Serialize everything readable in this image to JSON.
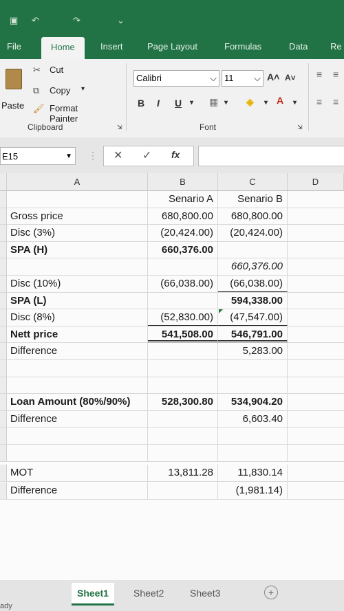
{
  "ribbon_tabs": [
    "File",
    "Home",
    "Insert",
    "Page Layout",
    "Formulas",
    "Data",
    "Re"
  ],
  "clipboard": {
    "paste": "Paste",
    "cut": "Cut",
    "copy": "Copy",
    "format_painter": "Format Painter",
    "group": "Clipboard"
  },
  "font": {
    "name": "Calibri",
    "size": "11",
    "group": "Font",
    "bold": "B",
    "italic": "I",
    "underline": "U"
  },
  "name_box": "E15",
  "fx": "fx",
  "columns": [
    "A",
    "B",
    "C",
    "D"
  ],
  "rows": [
    {
      "a": "",
      "b": "Senario A",
      "c": "Senario B"
    },
    {
      "a": "Gross price",
      "b": "680,800.00",
      "c": "680,800.00"
    },
    {
      "a": "Disc (3%)",
      "b": "(20,424.00)",
      "c": "(20,424.00)"
    },
    {
      "a": "SPA (H)",
      "b": "660,376.00",
      "c": ""
    },
    {
      "a": "",
      "b": "",
      "c": "660,376.00"
    },
    {
      "a": "Disc (10%)",
      "b": "(66,038.00)",
      "c": "(66,038.00)"
    },
    {
      "a": "SPA (L)",
      "b": "",
      "c": "594,338.00"
    },
    {
      "a": "Disc (8%)",
      "b": "(52,830.00)",
      "c": "(47,547.00)"
    },
    {
      "a": "Nett price",
      "b": "541,508.00",
      "c": "546,791.00"
    },
    {
      "a": "Difference",
      "b": "",
      "c": "5,283.00"
    },
    {
      "a": "",
      "b": "",
      "c": ""
    },
    {
      "a": "",
      "b": "",
      "c": ""
    },
    {
      "a": "Loan Amount (80%/90%)",
      "b": "528,300.80",
      "c": "534,904.20"
    },
    {
      "a": "Difference",
      "b": "",
      "c": "6,603.40"
    },
    {
      "a": "",
      "b": "",
      "c": ""
    },
    {
      "a": "",
      "b": "",
      "c": ""
    },
    {
      "a": "MOT",
      "b": "13,811.28",
      "c": "11,830.14"
    },
    {
      "a": "Difference",
      "b": "",
      "c": "(1,981.14)"
    }
  ],
  "sheets": [
    "Sheet1",
    "Sheet2",
    "Sheet3"
  ],
  "status": "ady",
  "accent": "#217346"
}
